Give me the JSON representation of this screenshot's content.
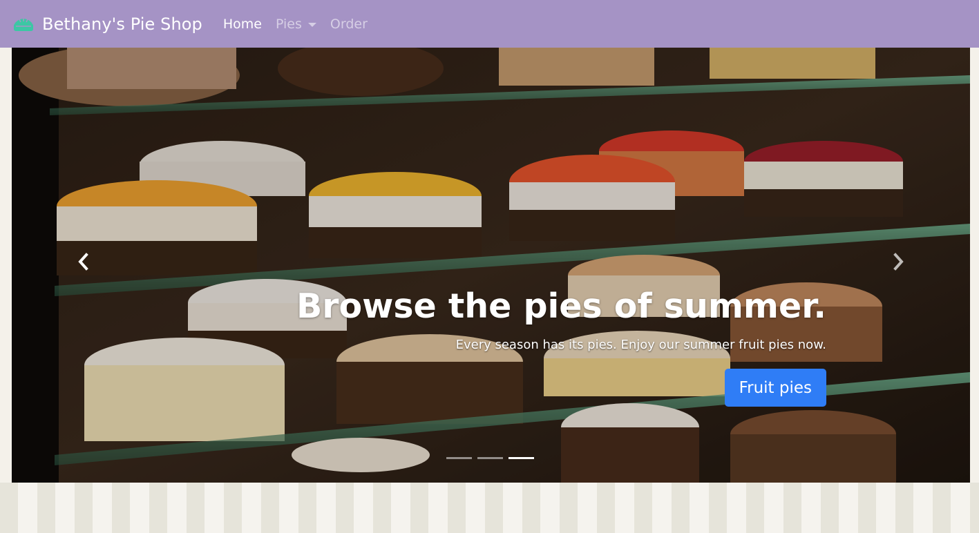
{
  "navbar": {
    "brand": "Bethany's Pie Shop",
    "brand_icon": "pie-icon",
    "brand_icon_color": "#3cc7a4",
    "background": "#a593c5",
    "links": [
      {
        "label": "Home",
        "active": true
      },
      {
        "label": "Pies",
        "dropdown": true
      },
      {
        "label": "Order"
      }
    ]
  },
  "carousel": {
    "image": "bakery display case with cakes and pies",
    "prev_icon": "chevron-left-icon",
    "next_icon": "chevron-right-icon",
    "caption": {
      "title": "Browse the pies of summer.",
      "text": "Every season has its pies. Enjoy our summer fruit pies now.",
      "button": "Fruit pies",
      "button_color": "#2f7df6"
    },
    "indicators": 3,
    "active_indicator": 3
  }
}
